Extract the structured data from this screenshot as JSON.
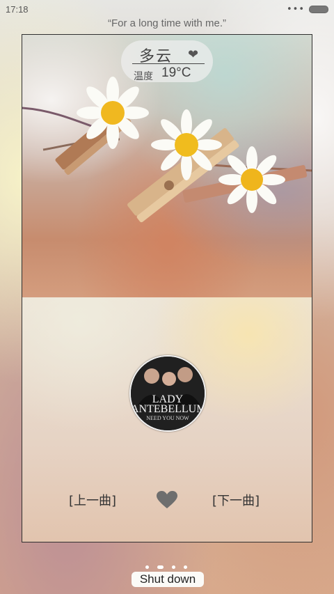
{
  "status_bar": {
    "time": "17:18",
    "menu_dots": "•••"
  },
  "quote": "“For a long time with me.”",
  "weather": {
    "condition": "多云",
    "temperature_label": "温度",
    "temperature_value": "19°C",
    "icon": "heart-icon"
  },
  "album": {
    "title_line1": "LADY",
    "title_line2": "ANTEBELLUM",
    "subtitle": "NEED YOU NOW"
  },
  "player": {
    "prev_label": "[上一曲]",
    "next_label": "[下一曲]",
    "favorite_icon": "heart-icon"
  },
  "footer": {
    "shutdown_label": "Shut down",
    "page_count": 4,
    "active_page": 2
  },
  "colors": {
    "text_dark": "#333333",
    "frame": "#2f2f2f"
  }
}
